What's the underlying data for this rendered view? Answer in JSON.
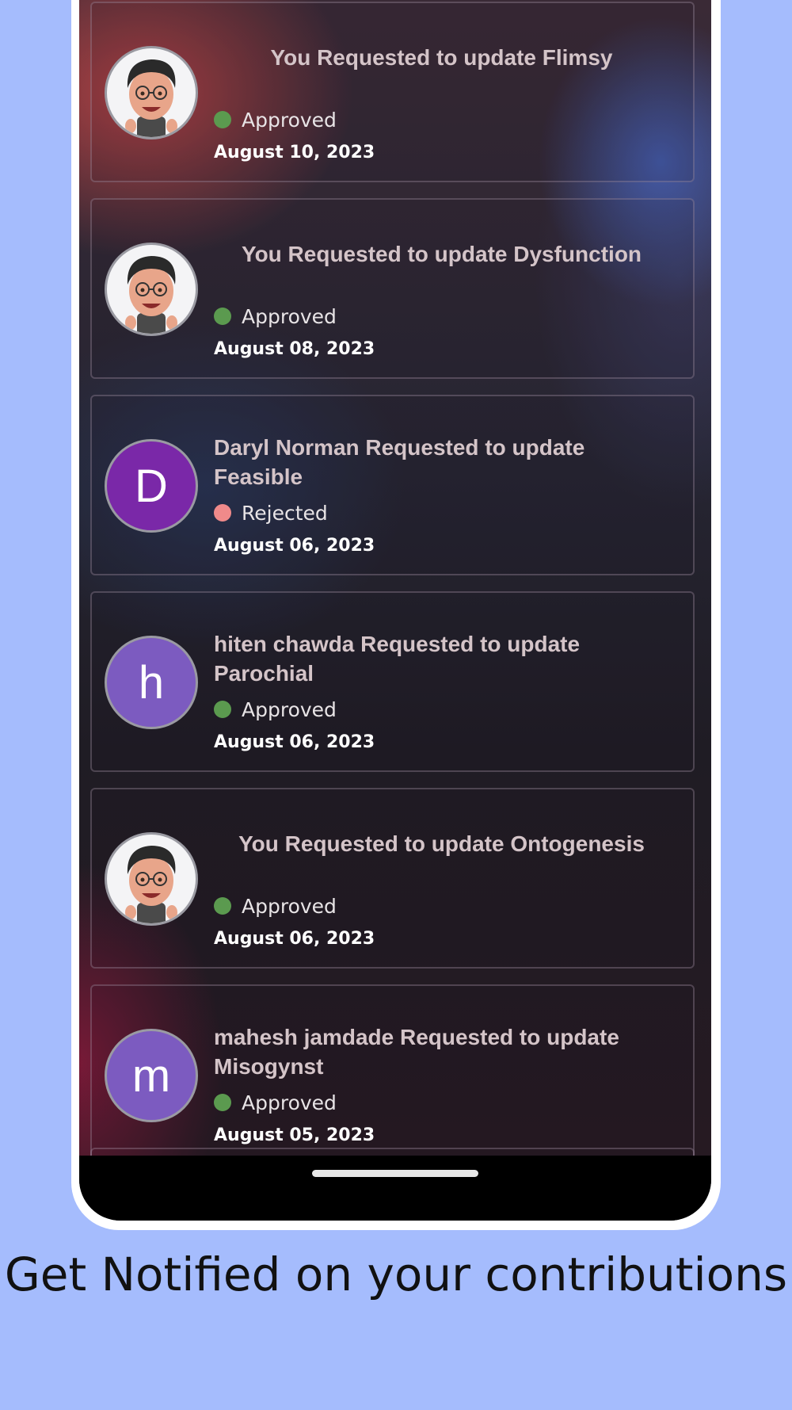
{
  "notifications": [
    {
      "title": "You Requested to update Flimsy",
      "status": "Approved",
      "status_color": "#5b9a4f",
      "date": "August 10, 2023",
      "avatar": "memoji-avatar"
    },
    {
      "title": "You Requested to update Dysfunction",
      "status": "Approved",
      "status_color": "#5b9a4f",
      "date": "August 08, 2023",
      "avatar": "memoji-avatar"
    },
    {
      "title": "Daryl Norman Requested to update Feasible",
      "status": "Rejected",
      "status_color": "#f08a8a",
      "date": "August 06, 2023",
      "avatar_letter": "D",
      "avatar_color": "#7a28a8"
    },
    {
      "title": "hiten chawda Requested to update Parochial",
      "status": "Approved",
      "status_color": "#5b9a4f",
      "date": "August 06, 2023",
      "avatar_letter": "h",
      "avatar_color": "#7c5bc0"
    },
    {
      "title": "You Requested to update Ontogenesis",
      "status": "Approved",
      "status_color": "#5b9a4f",
      "date": "August 06, 2023",
      "avatar": "memoji-avatar"
    },
    {
      "title": "mahesh jamdade Requested to update Misogynst",
      "status": "Approved",
      "status_color": "#5b9a4f",
      "date": "August 05, 2023",
      "avatar_letter": "m",
      "avatar_color": "#7c5bc0"
    }
  ],
  "caption": "Get Notified on your contributions",
  "colors": {
    "background": "#a5bcfd",
    "approved": "#5b9a4f",
    "rejected": "#f08a8a"
  }
}
